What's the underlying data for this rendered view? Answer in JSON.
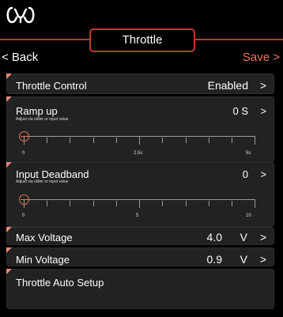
{
  "header": {
    "title": "Throttle",
    "back_label": "< Back",
    "save_label": "Save >"
  },
  "rows": {
    "throttle_control": {
      "label": "Throttle Control",
      "value": "Enabled",
      "chevron": ">"
    },
    "ramp_up": {
      "label": "Ramp up",
      "hint": "Adjust via slider or input value",
      "value": "0 S",
      "chevron": ">",
      "slider": {
        "min_label": "0",
        "mid_label": "2.5s",
        "max_label": "5s",
        "level": 0
      }
    },
    "input_deadband": {
      "label": "Input Deadband",
      "hint": "Adjust via slider or input value",
      "value": "0",
      "chevron": ">",
      "slider": {
        "min_label": "0",
        "mid_label": "5",
        "max_label": "10",
        "level": 0
      }
    },
    "max_voltage": {
      "label": "Max Voltage",
      "value": "4.0",
      "unit": "V",
      "chevron": ">"
    },
    "min_voltage": {
      "label": "Min Voltage",
      "value": "0.9",
      "unit": "V",
      "chevron": ">"
    },
    "auto_setup": {
      "label": "Throttle Auto Setup"
    }
  },
  "colors": {
    "accent": "#c0392b",
    "save": "#f0765b",
    "card": "#222222"
  },
  "icons": {
    "logo": "brand-logo-icon",
    "slider_thumb": "slider-thumb-icon"
  }
}
